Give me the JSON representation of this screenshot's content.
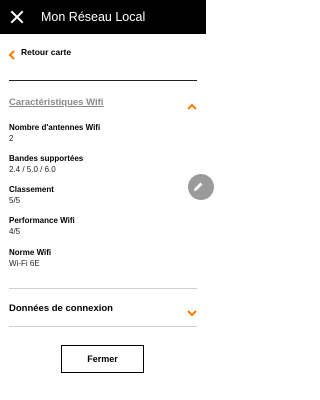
{
  "header": {
    "title": "Mon Réseau Local",
    "close_icon": "close-icon"
  },
  "nav": {
    "back_label": "Retour carte"
  },
  "wifi_section": {
    "title": "Caractéristiques Wifi",
    "expanded": true,
    "properties": [
      {
        "label": "Nombre d'antennes Wifi",
        "value": "2"
      },
      {
        "label": "Bandes supportées",
        "value": "2.4 / 5.0 / 6.0"
      },
      {
        "label": "Classement",
        "value": "5/5"
      },
      {
        "label": "Performance Wifi",
        "value": "4/5"
      },
      {
        "label": "Norme Wifi",
        "value": "Wi-Fi 6E"
      }
    ]
  },
  "connection_section": {
    "title": "Données de connexion",
    "expanded": false
  },
  "footer": {
    "close_label": "Fermer"
  },
  "colors": {
    "accent": "#ff7900",
    "header_bg": "#000000",
    "fab_bg": "#9a9a9a"
  },
  "icons": {
    "edit": "pencil-icon",
    "back": "chevron-left-icon",
    "expand": "chevron-up-icon",
    "collapse": "chevron-down-icon"
  }
}
